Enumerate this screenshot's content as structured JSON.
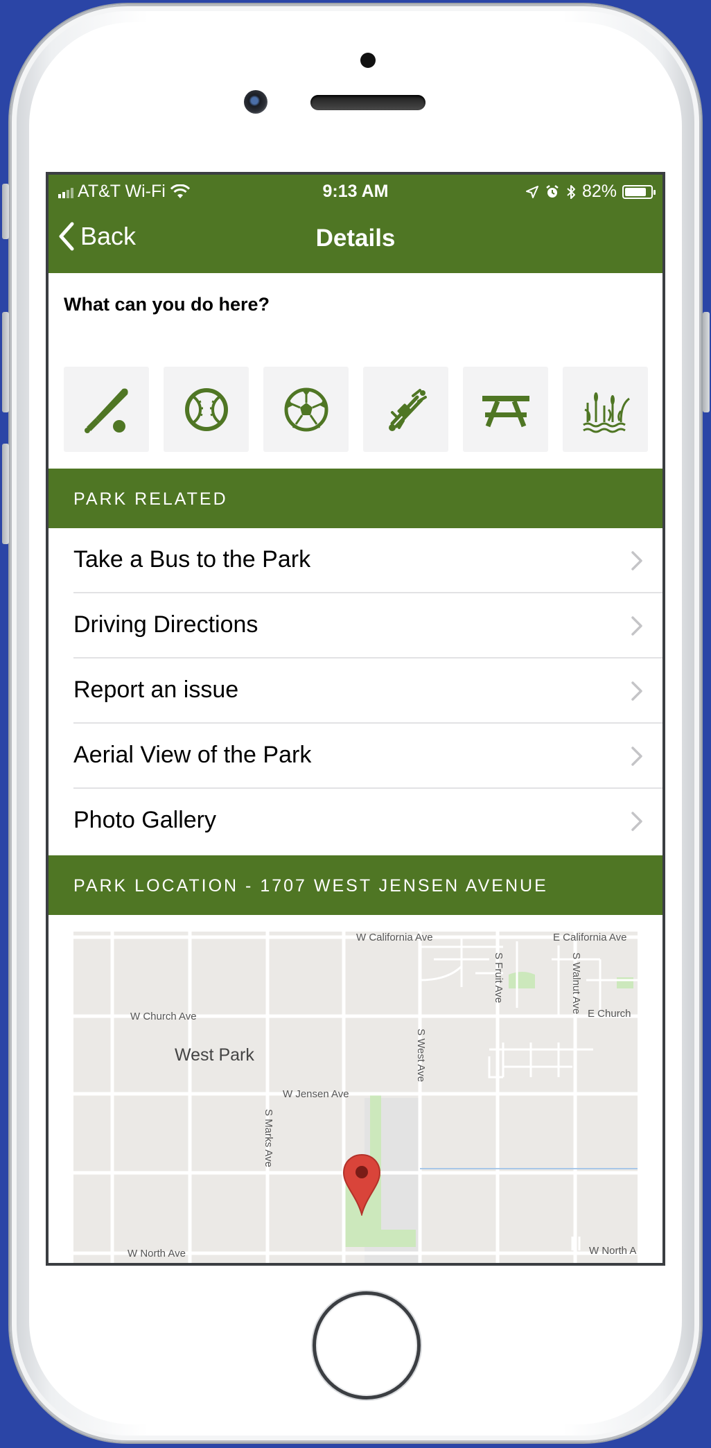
{
  "status_bar": {
    "carrier": "AT&T Wi-Fi",
    "time": "9:13 AM",
    "battery": "82%",
    "battery_level": 0.82
  },
  "nav": {
    "back_label": "Back",
    "title": "Details"
  },
  "activities": {
    "heading": "What can you do here?",
    "icons": [
      "baseball-bat-icon",
      "softball-icon",
      "soccer-ball-icon",
      "skatepark-icon",
      "picnic-table-icon",
      "wetlands-icon"
    ]
  },
  "park_related": {
    "header": "PARK RELATED",
    "items": [
      {
        "label": "Take a Bus to the Park"
      },
      {
        "label": "Driving Directions"
      },
      {
        "label": "Report an issue"
      },
      {
        "label": "Aerial View of the Park"
      },
      {
        "label": "Photo Gallery"
      }
    ]
  },
  "park_location": {
    "header": "PARK LOCATION - 1707 WEST JENSEN AVENUE",
    "map": {
      "labels": {
        "w_california": "W California Ave",
        "e_california": "E California Ave",
        "w_church": "W Church Ave",
        "e_church": "E Church",
        "west_park": "West Park",
        "w_jensen": "W Jensen Ave",
        "s_marks": "S Marks Ave",
        "s_west": "S West Ave",
        "s_fruit": "S Fruit Ave",
        "s_walnut": "S Walnut Ave",
        "w_north": "W North Ave",
        "w_north_right": "W North A"
      }
    }
  },
  "colors": {
    "brand_green": "#4f7624",
    "background_blue": "#2b45a6",
    "map_pin": "#d9443a"
  }
}
